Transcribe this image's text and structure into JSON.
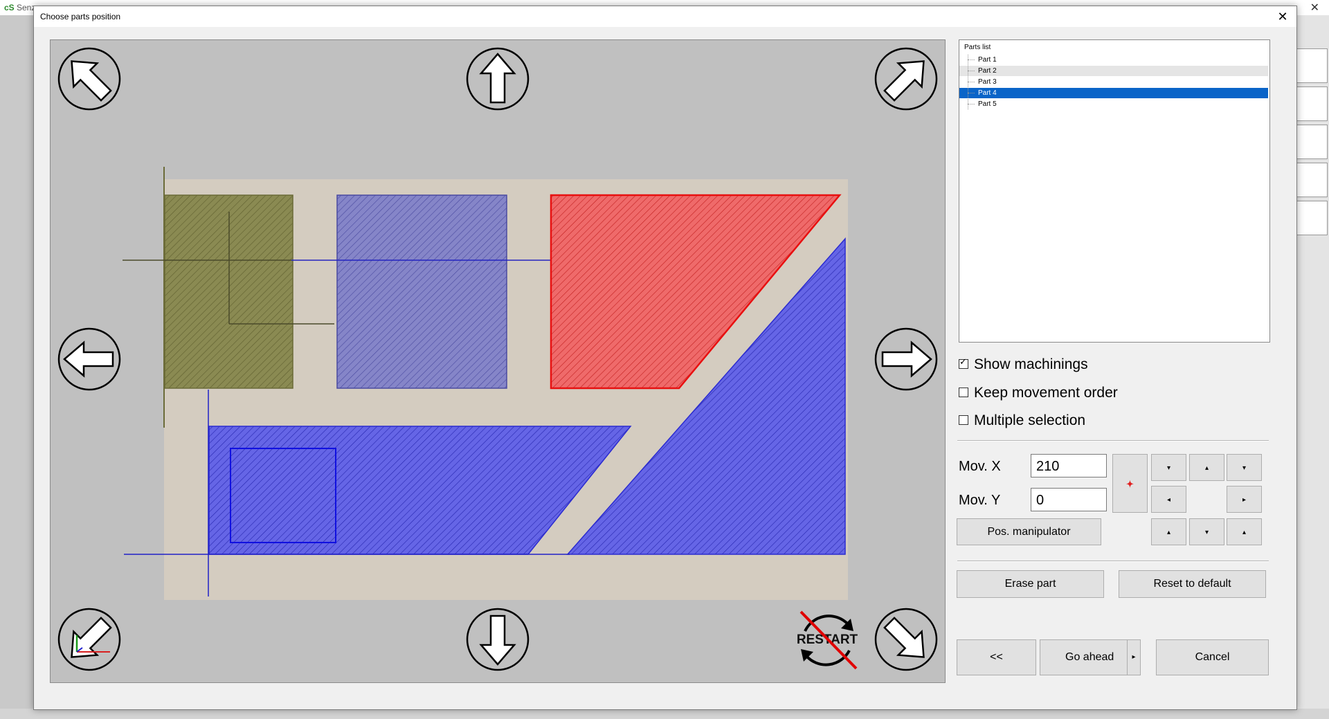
{
  "background": {
    "app_title": "Senz",
    "app_icon": "app-logo-icon"
  },
  "dialog": {
    "title": "Choose parts position",
    "close_label": "✕"
  },
  "canvas": {
    "restart_label": "RESTART",
    "nav_icons": [
      "arrow-up-left-icon",
      "arrow-up-icon",
      "arrow-up-right-icon",
      "arrow-left-icon",
      "arrow-right-icon",
      "arrow-down-left-icon",
      "arrow-down-icon",
      "arrow-down-right-icon",
      "restart-disabled-icon"
    ],
    "colors": {
      "sheet": "#d4ccc0",
      "part_olive": "#8a8a52",
      "part_blue": "#5b5be0",
      "part_selected": "#ef5555"
    }
  },
  "parts_list": {
    "title": "Parts list",
    "items": [
      "Part 1",
      "Part 2",
      "Part 3",
      "Part 4",
      "Part 5"
    ],
    "selected": "Part 4",
    "hovered": "Part 2"
  },
  "options": {
    "show_machinings": {
      "label": "Show machinings",
      "checked": true
    },
    "keep_movement_order": {
      "label": "Keep movement order",
      "checked": false
    },
    "multiple_selection": {
      "label": "Multiple selection",
      "checked": false
    }
  },
  "movement": {
    "x_label": "Mov. X",
    "x_value": "210",
    "y_label": "Mov. Y",
    "y_value": "0",
    "pos_manipulator_label": "Pos. manipulator",
    "center_symbol": "✦",
    "step_buttons": [
      "▾",
      "▴",
      "▾",
      "◂",
      "▸",
      "▴",
      "▾",
      "▴"
    ]
  },
  "actions": {
    "erase_part": "Erase part",
    "reset_default": "Reset to default",
    "back": "<<",
    "go_ahead": "Go ahead",
    "go_ahead_arrow": "▸",
    "cancel": "Cancel"
  }
}
